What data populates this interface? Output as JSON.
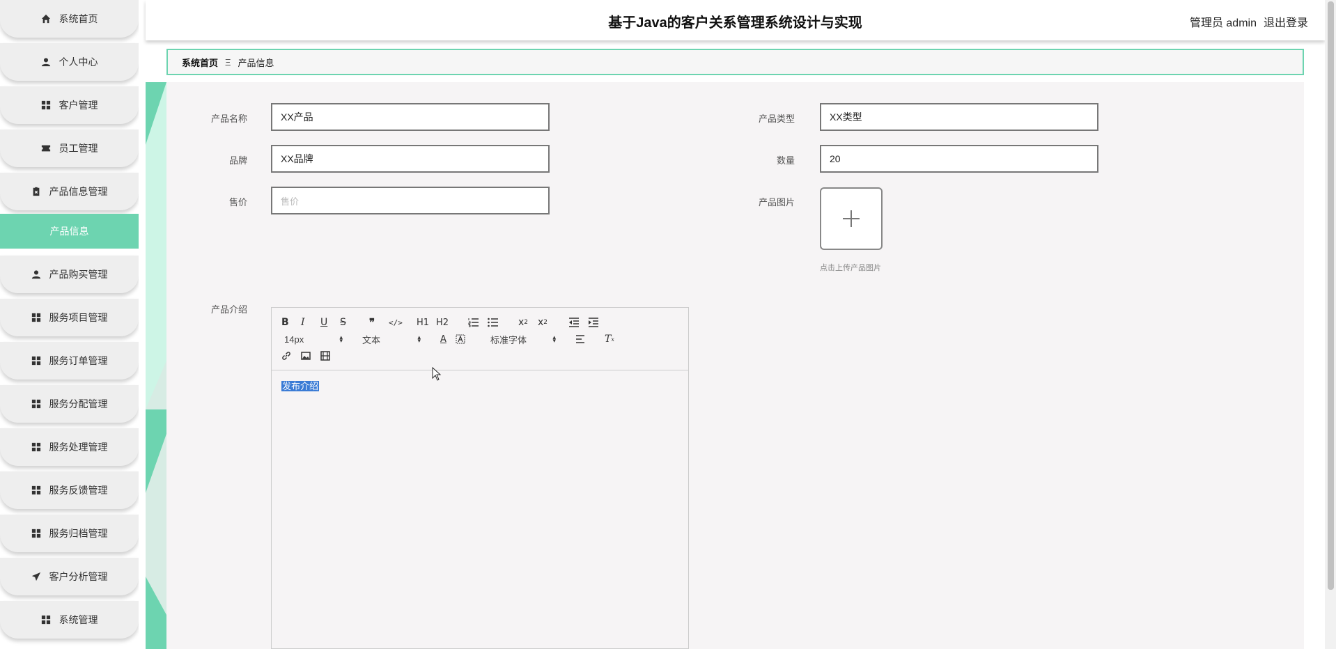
{
  "app_title": "基于Java的客户关系管理系统设计与实现",
  "header": {
    "user_label": "管理员 admin",
    "logout": "退出登录"
  },
  "sidebar": {
    "items": [
      {
        "label": "系统首页",
        "icon": "home-icon"
      },
      {
        "label": "个人中心",
        "icon": "user-icon"
      },
      {
        "label": "客户管理",
        "icon": "grid-icon"
      },
      {
        "label": "员工管理",
        "icon": "ticket-icon"
      },
      {
        "label": "产品信息管理",
        "icon": "clipboard-icon"
      },
      {
        "label": "产品购买管理",
        "icon": "user-icon"
      },
      {
        "label": "服务项目管理",
        "icon": "grid-icon"
      },
      {
        "label": "服务订单管理",
        "icon": "grid-icon"
      },
      {
        "label": "服务分配管理",
        "icon": "grid-icon"
      },
      {
        "label": "服务处理管理",
        "icon": "grid-icon"
      },
      {
        "label": "服务反馈管理",
        "icon": "grid-icon"
      },
      {
        "label": "服务归档管理",
        "icon": "grid-icon"
      },
      {
        "label": "客户分析管理",
        "icon": "send-icon"
      },
      {
        "label": "系统管理",
        "icon": "grid-icon"
      }
    ],
    "active_submenu": "产品信息",
    "accent_color": "#6dd4b0"
  },
  "breadcrumb": {
    "home": "系统首页",
    "separator": "Ξ",
    "current": "产品信息"
  },
  "form": {
    "product_name": {
      "label": "产品名称",
      "value": "XX产品"
    },
    "product_type": {
      "label": "产品类型",
      "value": "XX类型"
    },
    "brand": {
      "label": "品牌",
      "value": "XX品牌"
    },
    "quantity": {
      "label": "数量",
      "value": "20"
    },
    "price": {
      "label": "售价",
      "value": "",
      "placeholder": "售价"
    },
    "product_image": {
      "label": "产品图片",
      "hint": "点击上传产品图片"
    },
    "intro": {
      "label": "产品介绍",
      "content": "发布介绍"
    }
  },
  "editor_toolbar": {
    "font_size": "14px",
    "text_style": "文本",
    "font_family": "标准字体",
    "h1": "H1",
    "h2": "H2"
  }
}
